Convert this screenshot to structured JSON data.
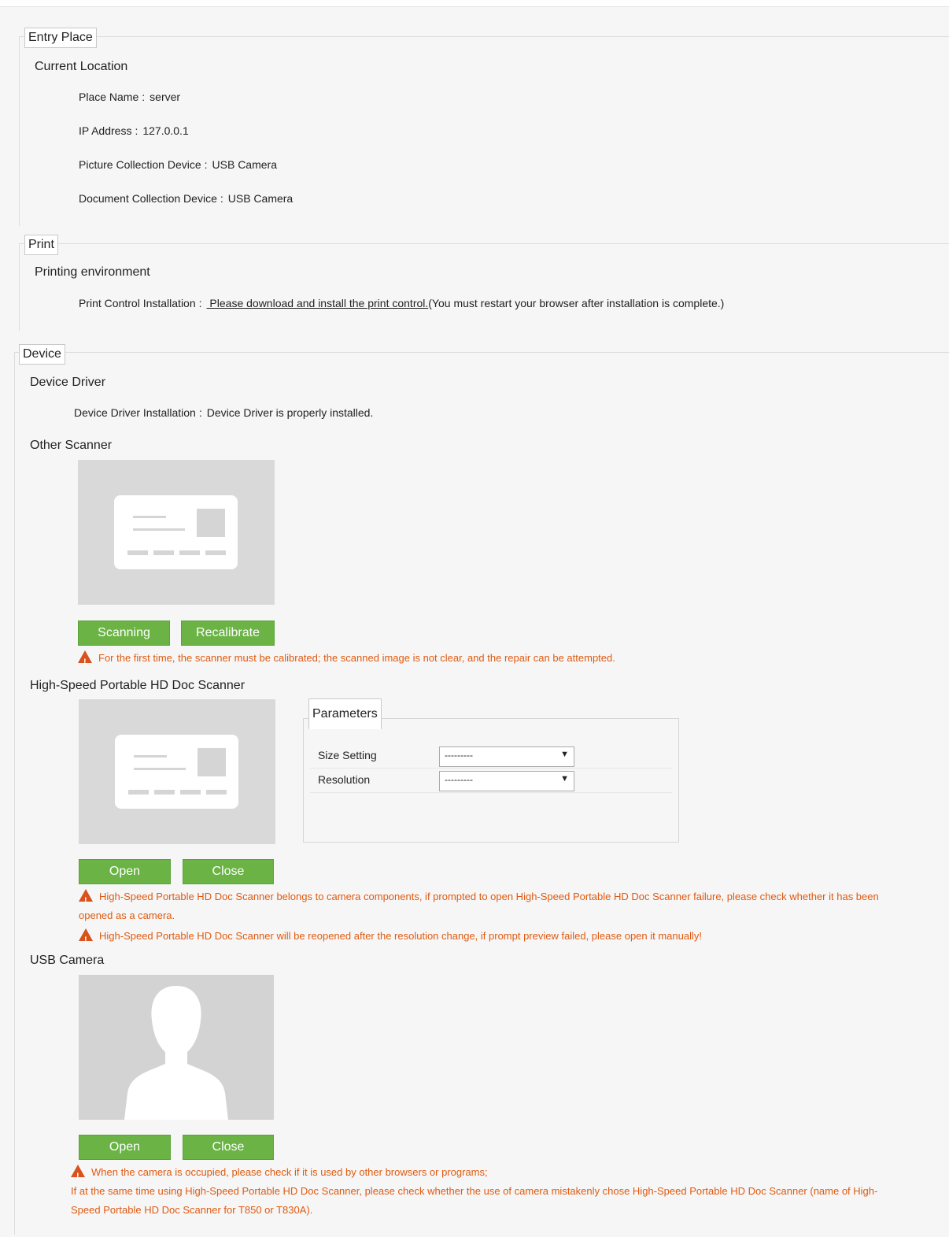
{
  "entry": {
    "legend": "Entry Place",
    "subhead": "Current Location",
    "rows": [
      {
        "label": "Place Name",
        "value": "server"
      },
      {
        "label": "IP Address",
        "value": "127.0.0.1"
      },
      {
        "label": "Picture Collection Device",
        "value": "USB Camera"
      },
      {
        "label": "Document Collection Device",
        "value": "USB Camera"
      }
    ]
  },
  "print": {
    "legend": "Print",
    "subhead": "Printing environment",
    "label": "Print Control Installation",
    "link": " Please download and install the print control.",
    "note": "(You must restart your browser after installation is complete.)"
  },
  "device": {
    "legend": "Device",
    "driver_subhead": "Device Driver",
    "driver_label": "Device Driver Installation",
    "driver_value": "Device Driver is properly installed.",
    "other_subhead": "Other Scanner",
    "scan_btn": "Scanning",
    "recal_btn": "Recalibrate",
    "other_warn": "For the first time, the scanner must be calibrated; the scanned image is not clear, and the repair can be attempted.",
    "hs_subhead": "High-Speed Portable HD Doc Scanner",
    "params_legend": "Parameters",
    "size_label": "Size Setting",
    "size_value": "---------",
    "res_label": "Resolution",
    "res_value": "---------",
    "hs_open": "Open",
    "hs_close": "Close",
    "hs_warn1a": "High-Speed Portable HD Doc Scanner belongs to camera components, if prompted to open High-Speed Portable HD Doc Scanner failure, please check whether it has been",
    "hs_warn1b": "opened as a camera.",
    "hs_warn2": "High-Speed Portable HD Doc Scanner will be reopened after the resolution change, if prompt preview failed, please open it manually!",
    "usb_subhead": "USB Camera",
    "usb_open": "Open",
    "usb_close": "Close",
    "usb_warn1": "When the camera is occupied, please check if it is used by other browsers or programs;",
    "usb_warn2": "If at the same time using High-Speed Portable HD Doc Scanner, please check whether the use of camera mistakenly chose High-Speed Portable HD Doc Scanner (name of High-",
    "usb_warn3": "Speed Portable HD Doc Scanner for T850 or T830A)."
  },
  "separator": ":",
  "colors": {
    "button": "#6ab344",
    "warning": "#e05a10",
    "placeholder": "#d9d9d9"
  }
}
